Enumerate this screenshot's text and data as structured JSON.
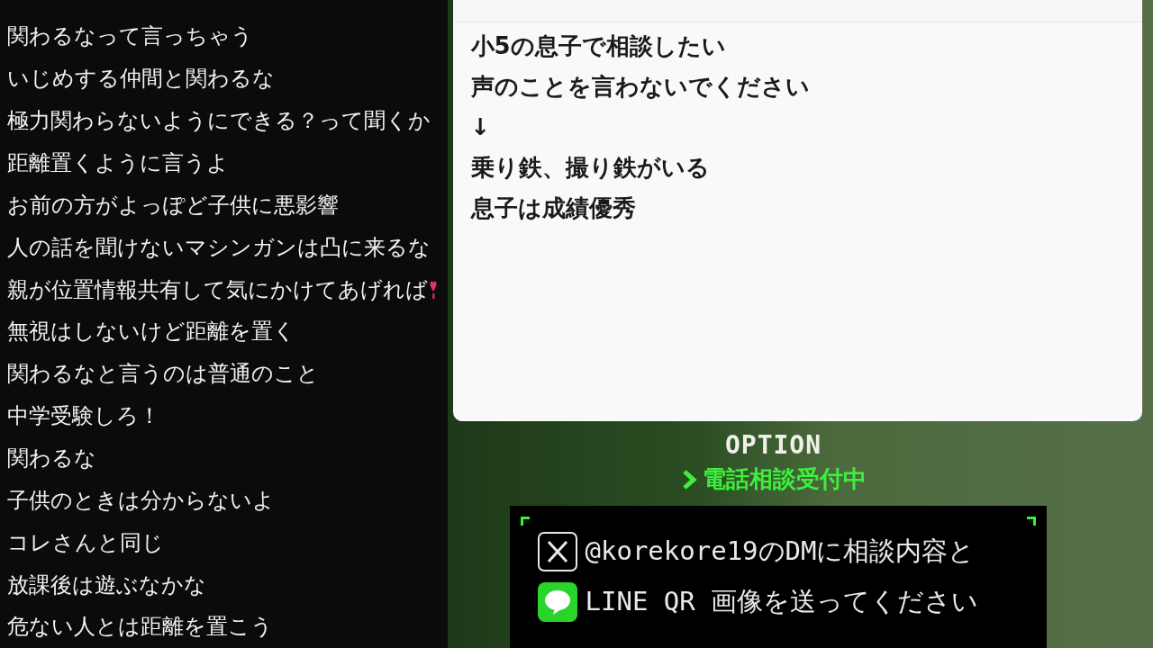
{
  "chat": {
    "comments": [
      {
        "text": "関わるなって言っちゃう",
        "emoji": false
      },
      {
        "text": "いじめする仲間と関わるな",
        "emoji": false
      },
      {
        "text": "極力関わらないようにできる？って聞くか",
        "emoji": false
      },
      {
        "text": "距離置くように言うよ",
        "emoji": false
      },
      {
        "text": "お前の方がよっぽど子供に悪影響",
        "emoji": false
      },
      {
        "text": "人の話を聞けないマシンガンは凸に来るな",
        "emoji": false
      },
      {
        "text": "親が位置情報共有して気にかけてあげれば",
        "emoji": true
      },
      {
        "text": "無視はしないけど距離を置く",
        "emoji": false
      },
      {
        "text": "関わるなと言うのは普通のこと",
        "emoji": false
      },
      {
        "text": "中学受験しろ！",
        "emoji": false
      },
      {
        "text": "関わるな",
        "emoji": false
      },
      {
        "text": "子供のときは分からないよ",
        "emoji": false
      },
      {
        "text": "コレさんと同じ",
        "emoji": false
      },
      {
        "text": "放課後は遊ぶなかな",
        "emoji": false
      },
      {
        "text": "危ない人とは距離を置こう",
        "emoji": false
      }
    ]
  },
  "notepad": {
    "lines": [
      "小5の息子で相談したい",
      "声のことを言わないでください",
      "↓",
      "乗り鉄、撮り鉄がいる",
      "息子は成績優秀"
    ]
  },
  "overlay": {
    "title": "OPTION",
    "status": "電話相談受付中",
    "contacts": [
      {
        "kind": "x",
        "text": "@korekore19のDMに相談内容と"
      },
      {
        "kind": "line",
        "text": "LINE QR 画像を送ってください"
      }
    ]
  }
}
